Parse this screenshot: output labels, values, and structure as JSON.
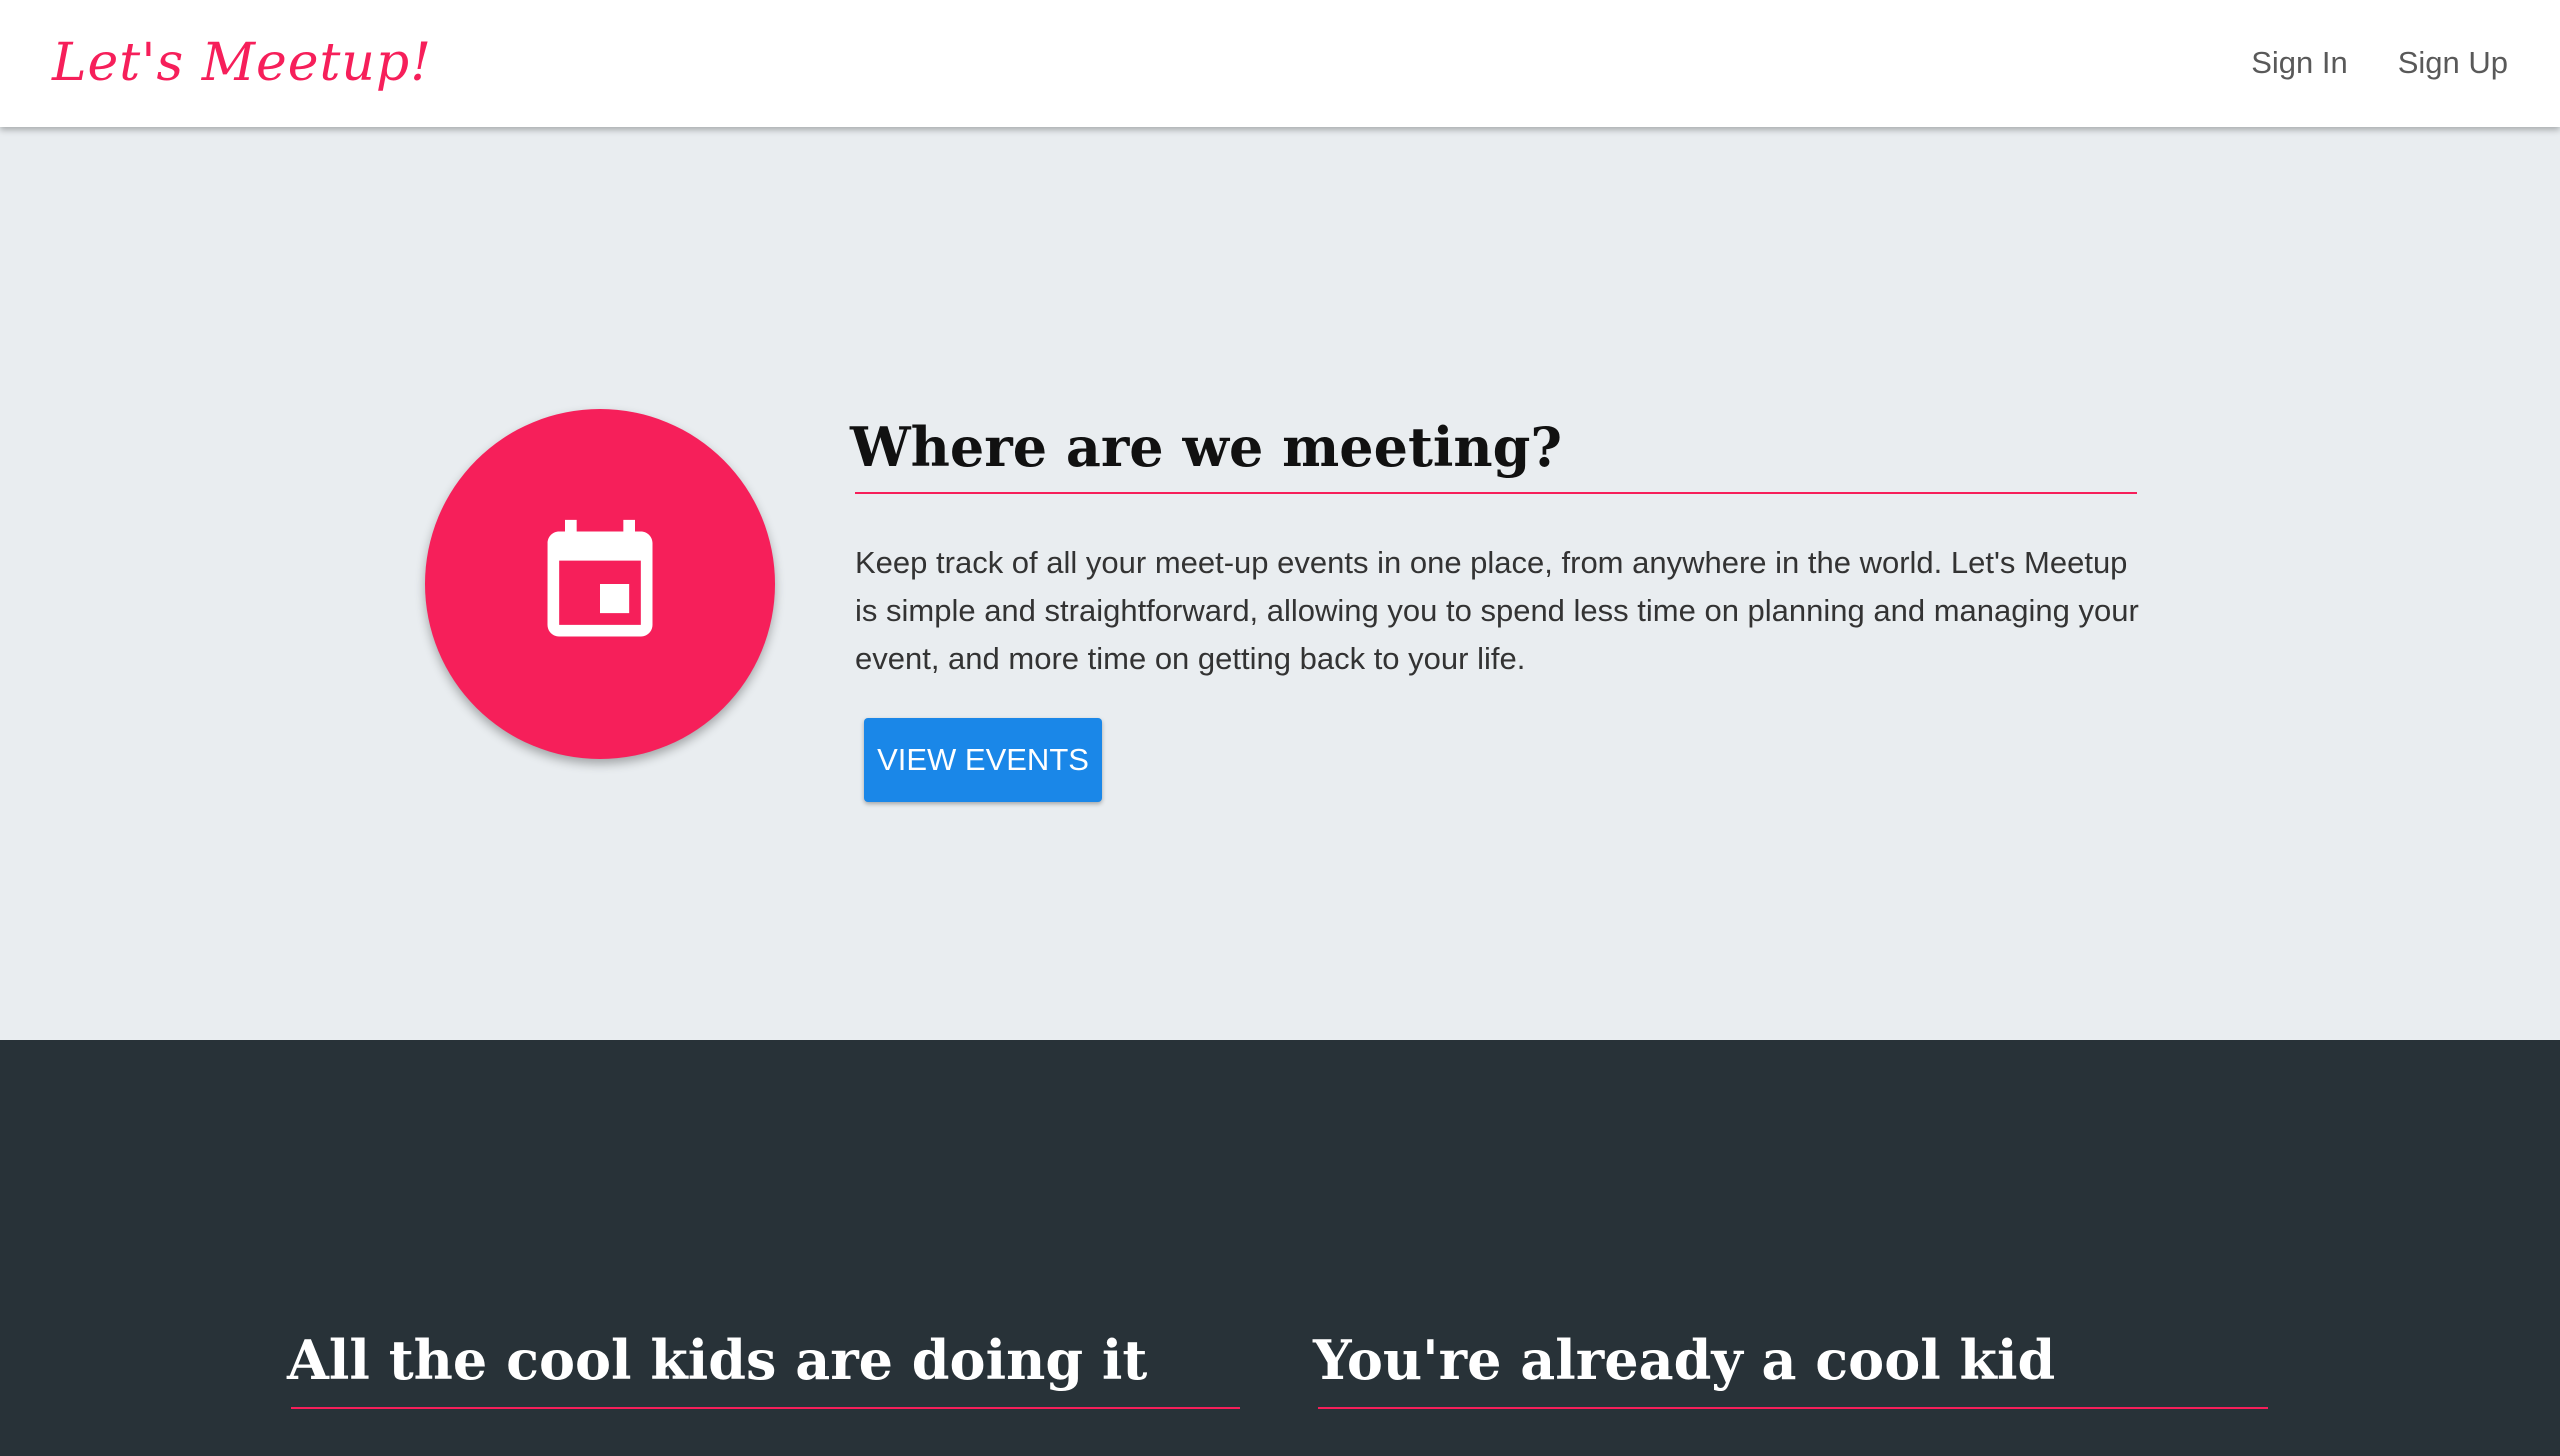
{
  "navbar": {
    "brand": "Let's Meetup!",
    "links": [
      "Sign In",
      "Sign Up"
    ]
  },
  "hero": {
    "icon": "calendar-icon",
    "title": "Where are we meeting?",
    "description": "Keep track of all your meet-up events in one place, from anywhere in the world. Let's Meetup is simple and straightforward, allowing you to spend less time on planning and managing your event, and more time on getting back to your life.",
    "button_label": "VIEW EVENTS"
  },
  "features": {
    "left_title": "All the cool kids are doing it",
    "right_title": "You're already a cool kid"
  },
  "colors": {
    "accent": "#f61f5a",
    "primary_button": "#1a87e8",
    "hero_background": "#e9edf0",
    "dark_background": "#283238"
  }
}
